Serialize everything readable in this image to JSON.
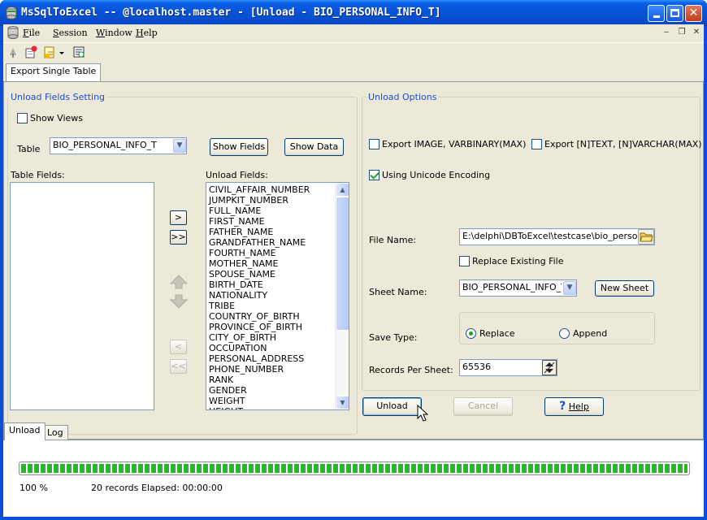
{
  "window": {
    "title": "MsSqlToExcel -- @localhost.master - [Unload - BIO_PERSONAL_INFO_T]"
  },
  "menu": {
    "items": [
      {
        "key": "F",
        "rest": "ile"
      },
      {
        "key": "S",
        "rest": "ession"
      },
      {
        "key": "W",
        "rest": "indow"
      },
      {
        "key": "H",
        "rest": "elp"
      }
    ]
  },
  "tabs": {
    "top": [
      "Export Single Table"
    ],
    "bottom": [
      "Unload",
      "Log"
    ]
  },
  "unload_fields_setting": {
    "group_label": "Unload Fields Setting",
    "show_views_label": "Show Views",
    "show_views_checked": false,
    "table_label": "Table",
    "table_value": "BIO_PERSONAL_INFO_T",
    "show_fields_label": "Show Fields",
    "show_data_label": "Show Data",
    "table_fields_label": "Table Fields:",
    "unload_fields_label": "Unload Fields:",
    "table_fields": [],
    "unload_fields": [
      "CIVIL_AFFAIR_NUMBER",
      "JUMPKIT_NUMBER",
      "FULL_NAME",
      "FIRST_NAME",
      "FATHER_NAME",
      "GRANDFATHER_NAME",
      "FOURTH_NAME",
      "MOTHER_NAME",
      "SPOUSE_NAME",
      "BIRTH_DATE",
      "NATIONALITY",
      "TRIBE",
      "COUNTRY_OF_BIRTH",
      "PROVINCE_OF_BIRTH",
      "CITY_OF_BIRTH",
      "OCCUPATION",
      "PERSONAL_ADDRESS",
      "PHONE_NUMBER",
      "RANK",
      "GENDER",
      "WEIGHT",
      "HEIGHT"
    ],
    "move_buttons": {
      "add_one": ">",
      "add_all": ">>",
      "remove_one": "<",
      "remove_all": "<<"
    }
  },
  "unload_options": {
    "group_label": "Unload Options",
    "export_image_label": "Export IMAGE, VARBINARY(MAX)",
    "export_image_checked": false,
    "export_ntext_label": "Export [N]TEXT, [N]VARCHAR(MAX)",
    "export_ntext_checked": false,
    "unicode_label": "Using Unicode Encoding",
    "unicode_checked": true,
    "file_name_label": "File Name:",
    "file_name_value": "E:\\delphi\\DBToExcel\\testcase\\bio_persona",
    "replace_existing_label": "Replace Existing File",
    "replace_existing_checked": false,
    "sheet_name_label": "Sheet Name:",
    "sheet_name_value": "BIO_PERSONAL_INFO_T",
    "new_sheet_label": "New Sheet",
    "save_type_label": "Save Type:",
    "save_type_options": [
      "Replace",
      "Append"
    ],
    "save_type_selected": "Replace",
    "records_per_sheet_label": "Records Per Sheet:",
    "records_per_sheet_value": "65536"
  },
  "actions": {
    "unload_label": "Unload",
    "cancel_label": "Cancel",
    "help_label": "Help"
  },
  "status": {
    "progress_fraction": 1.0,
    "percent_text": "100 %",
    "records_text": "20 records",
    "elapsed_text": "Elapsed: 00:00:00"
  },
  "colors": {
    "titlebar": "#0553d6",
    "group_label": "#1e4bd2",
    "progress": "#2fb32f",
    "checkmark": "#21a121"
  }
}
